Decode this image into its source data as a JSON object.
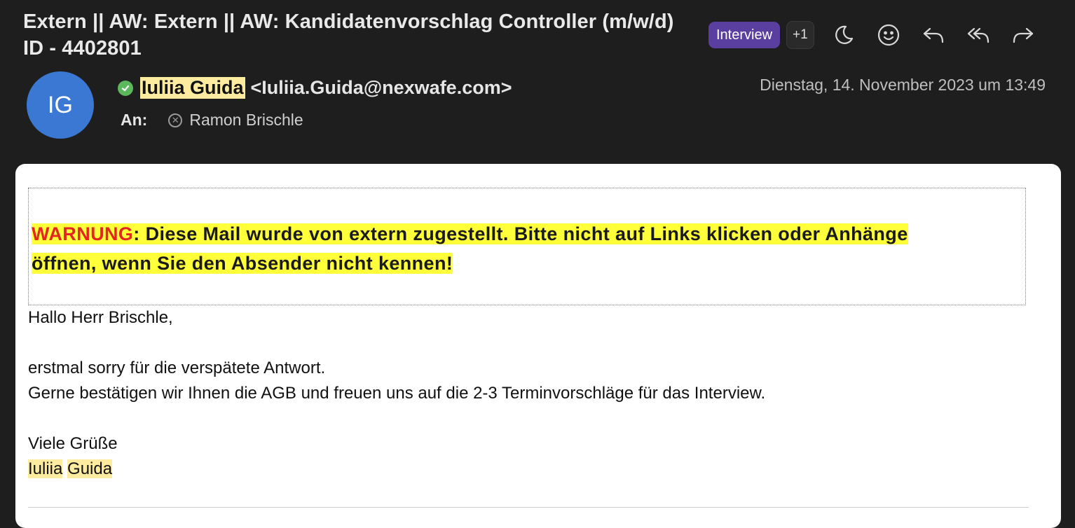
{
  "subject": "Extern || AW: Extern || AW: Kandidatenvorschlag Controller (m/w/d) ID - 4402801",
  "toolbar": {
    "tag_label": "Interview",
    "extra_tags": "+1",
    "icons": [
      "moon-icon",
      "smiley-icon",
      "reply-icon",
      "reply-all-icon",
      "forward-icon"
    ]
  },
  "sender": {
    "initials": "IG",
    "name": "Iuliia Guida",
    "email": "<Iuliia.Guida@nexwafe.com>",
    "avatar_color": "#3a78d3"
  },
  "date": "Dienstag, 14. November 2023 um 13:49",
  "recipient": {
    "label": "An:",
    "name": "Ramon Brischle"
  },
  "warning": {
    "keyword": "WARNUNG",
    "line1": ": Diese Mail wurde von extern zugestellt. Bitte nicht auf Links klicken oder Anhänge",
    "line2": "öffnen, wenn Sie den Absender nicht kennen!"
  },
  "body": {
    "greeting": "Hallo Herr Brischle,",
    "line1": "erstmal sorry für die verspätete Antwort.",
    "line2": "Gerne bestätigen wir Ihnen die AGB und freuen uns auf die 2-3 Terminvorschläge für das Interview.",
    "closing": "Viele Grüße",
    "sig_first": "Iuliia",
    "sig_last": "Guida"
  }
}
